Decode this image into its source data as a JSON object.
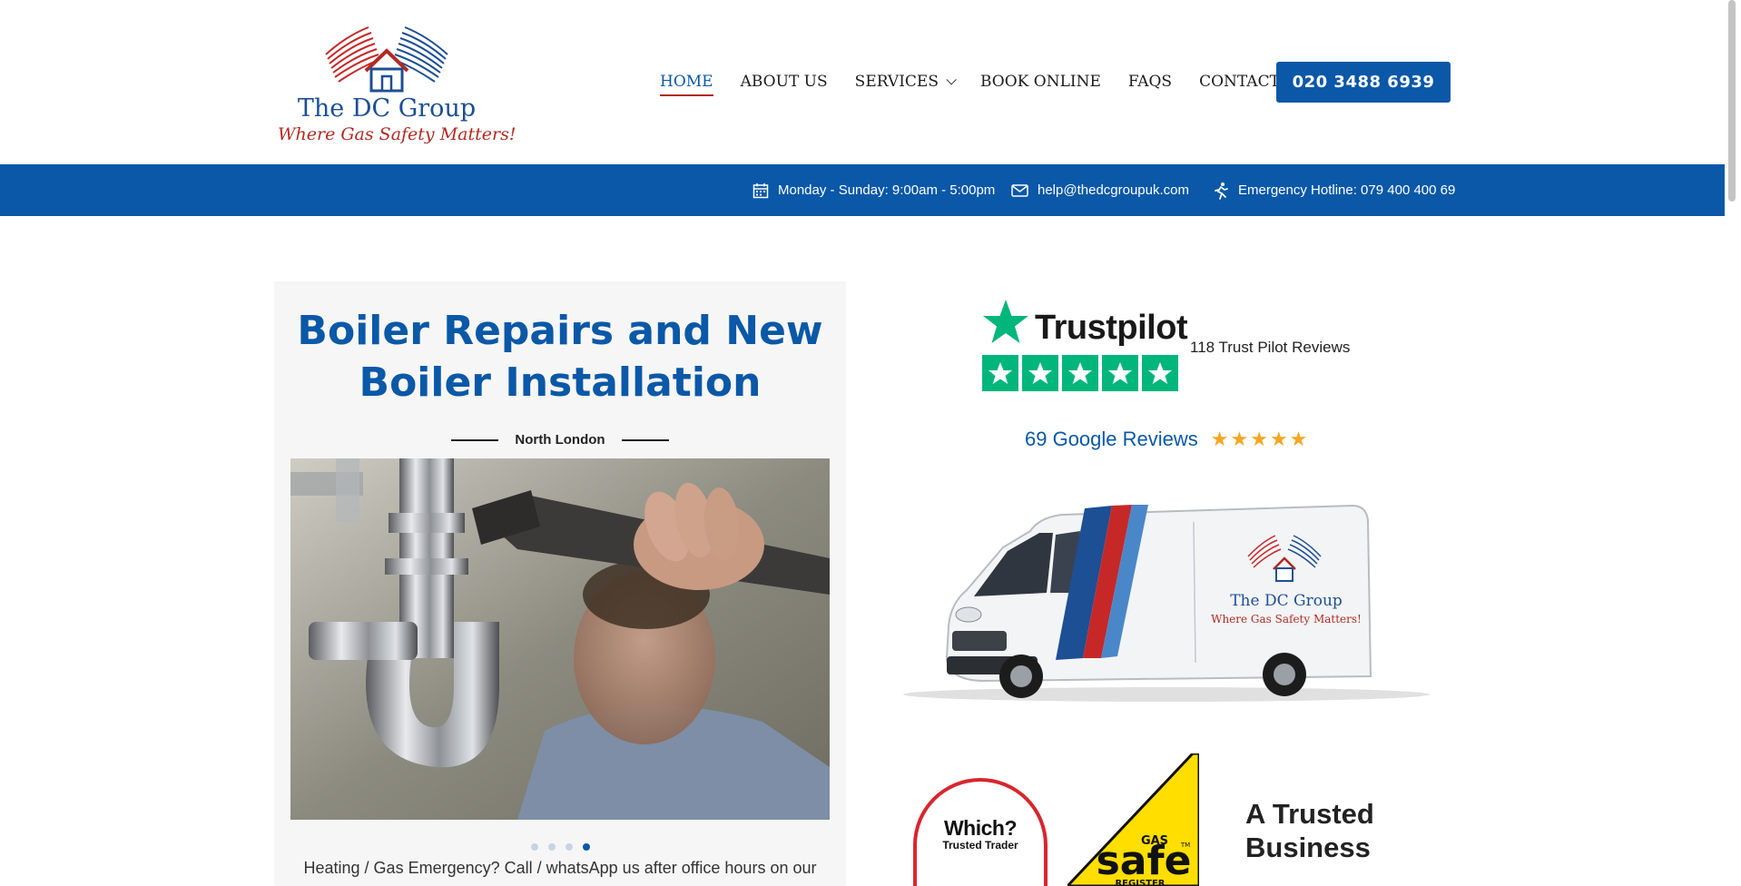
{
  "brand": {
    "name": "The DC Group",
    "tagline": "Where Gas Safety Matters!",
    "colors": {
      "primary": "#0a58a7",
      "accent": "#b02a22",
      "trustpilot": "#00b67a",
      "star": "#f5a623"
    }
  },
  "nav": {
    "items": [
      {
        "label": "HOME",
        "active": true
      },
      {
        "label": "ABOUT US"
      },
      {
        "label": "SERVICES",
        "dropdown": true
      },
      {
        "label": "BOOK ONLINE"
      },
      {
        "label": "FAQS"
      },
      {
        "label": "CONTACT"
      }
    ],
    "phone": "020 3488 6939"
  },
  "infobar": {
    "hours": "Monday - Sunday: 9:00am - 5:00pm",
    "email": "help@thedcgroupuk.com",
    "emergency": "Emergency Hotline: 079 400 400 69",
    "icons": [
      "calendar-icon",
      "envelope-icon",
      "running-person-icon"
    ]
  },
  "hero": {
    "title_line1": "Boiler Repairs and New",
    "title_line2": "Boiler Installation",
    "subtitle": "North London",
    "slides": 4,
    "active_slide": 4,
    "note": "Heating / Gas Emergency? Call / whatsApp us after office hours on our"
  },
  "reviews": {
    "trustpilot_word": "Trustpilot",
    "trustpilot_rating": 5,
    "trustpilot_count": "118 Trust Pilot Reviews",
    "google_text": "69 Google Reviews",
    "google_stars": "★★★★★"
  },
  "van": {
    "logo_name": "The DC Group",
    "logo_tag": "Where Gas Safety Matters!"
  },
  "badges": {
    "which_big": "Which?",
    "which_small": "Trusted Trader",
    "gassafe_top": "GAS",
    "gassafe_word": "safe",
    "gassafe_tm": "TM",
    "gassafe_bottom": "REGISTER",
    "trusted_line1": "A Trusted",
    "trusted_line2": "Business"
  }
}
